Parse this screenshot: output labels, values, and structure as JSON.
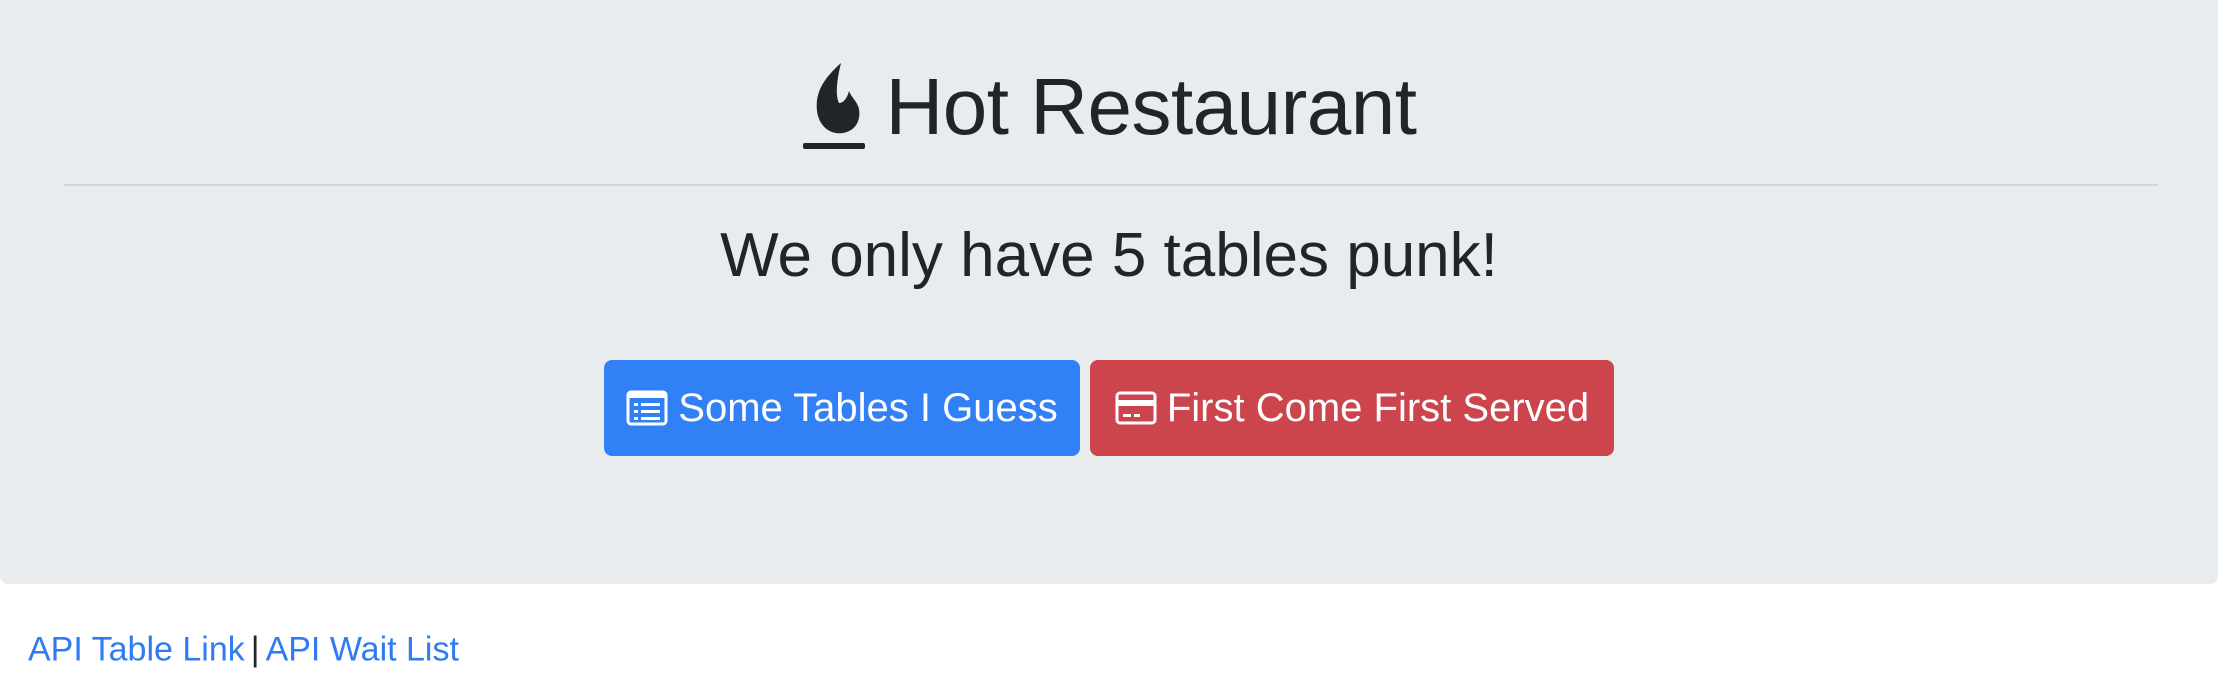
{
  "hero": {
    "icon": "fire-icon",
    "title": "Hot Restaurant",
    "subtitle": "We only have 5 tables punk!"
  },
  "buttons": {
    "tables": {
      "label": "Some Tables I Guess",
      "icon": "list-alt-icon",
      "color": "#3180f6"
    },
    "reserve": {
      "label": "First Come First Served",
      "icon": "credit-card-icon",
      "color": "#cc444c"
    }
  },
  "footer": {
    "api_table_link": "API Table Link",
    "separator": "|",
    "api_wait_list": "API Wait List",
    "link_color": "#2f7bf2"
  },
  "colors": {
    "jumbotron_bg": "#e9ecef",
    "text": "#212529"
  }
}
